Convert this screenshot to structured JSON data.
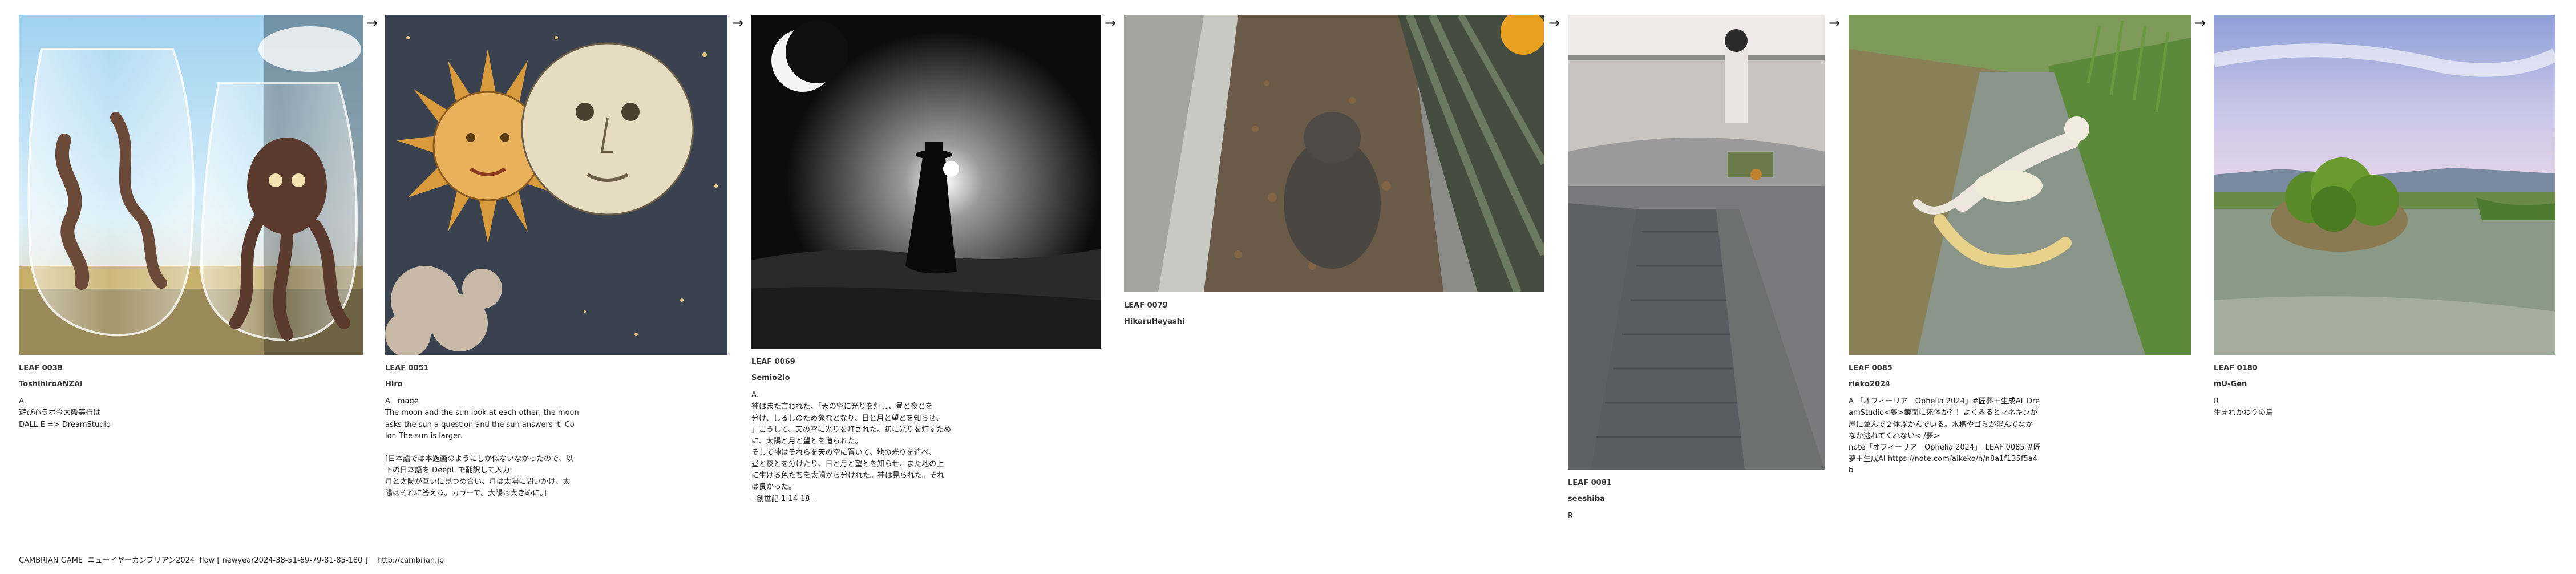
{
  "arrow_glyph": "→",
  "cards": [
    {
      "leaf": "LEAF 0038",
      "author": "ToshihiroANZAI",
      "desc": "A.\n遊び心ラボ今大阪等行は\nDALL-E => DreamStudio"
    },
    {
      "leaf": "LEAF 0051",
      "author": "Hiro",
      "desc": "A　mage\nThe moon and the sun look at each other, the moon\nasks the sun a question and the sun answers it. Co\nlor. The sun is larger.\n\n[日本語では本題画のようにしか似ないなかったので、以\n下の日本語を DeepL で翻訳して入力:\n月と太陽が互いに見つめ合い、月は太陽に問いかけ、太\n陽はそれに答える。カラーで。太陽は大きめに。]"
    },
    {
      "leaf": "LEAF 0069",
      "author": "Semio2lo",
      "desc": "A.\n神はまた言われた、「天の空に光りを灯し、昼と夜とを\n分け、しるしのため象なとなり、日と月と望とを知らせ、\n」こうして、天の空に光りを灯された。初に光りを灯すため\nに、太陽と月と望とを造られた。\nそして神はそれらを天の空に置いて、地の光りを造べ、\n昼と夜とを分けたり、日と月と望とを知らせ、また地の上\nに生ける色たちを太陽から分けれた。神は見られた。それ\nは良かった。\n- 創世記 1:14-18 -"
    },
    {
      "leaf": "LEAF 0079",
      "author": "HikaruHayashi",
      "desc": ""
    },
    {
      "leaf": "LEAF 0081",
      "author": "seeshiba",
      "desc": "R"
    },
    {
      "leaf": "LEAF 0085",
      "author": "rieko2024",
      "desc": "A 「オフィーリア　Ophelia 2024」#匠夢＋生成AI_Dre\namStudio<夢>鏡面に死体か？！よくみるとマネキンが\n屋に並んで２体浮かんでいる。水槽やゴミが混んでなか\nなか逃れてくれない< /夢>\nnote「オフィーリア　Ophelia 2024」_LEAF 0085 #匠\n夢＋生成AI https://note.com/aikeko/n/n8a1f135f5a4\nb"
    },
    {
      "leaf": "LEAF 0180",
      "author": "mU-Gen",
      "desc": "R\n生まれかわりの島"
    }
  ],
  "footer": "CAMBRIAN GAME  ニューイヤーカンブリアン2024  flow [ newyear2024-38-51-69-79-81-85-180 ]    http://cambrian.jp",
  "colors": {
    "text": "#222222",
    "background": "#ffffff",
    "arrow": "#111111"
  }
}
